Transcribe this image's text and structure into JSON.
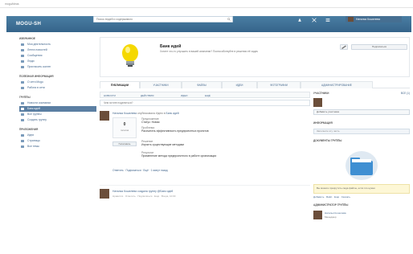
{
  "browser": {
    "address": "mogu/ideas"
  },
  "header": {
    "logo": "MOGU-SH",
    "search_placeholder": "Поиск людей и содержимого",
    "user_name": "Наталья Кошелева"
  },
  "sidebar": {
    "sections": [
      {
        "title": "Избранное",
        "items": [
          {
            "label": "Моя деятельность"
          },
          {
            "label": "Лента новостей"
          },
          {
            "label": "Сообщения"
          },
          {
            "label": "Люди"
          },
          {
            "label": "Пригласить коллег"
          }
        ]
      },
      {
        "title": "Полезная информация",
        "items": [
          {
            "label": "О сети Mogu"
          },
          {
            "label": "Работа в сети"
          }
        ]
      },
      {
        "title": "Группы",
        "items": [
          {
            "label": "Новости компании"
          },
          {
            "label": "Банк идей",
            "active": true
          },
          {
            "label": "Все группы"
          },
          {
            "label": "Создать группу"
          }
        ]
      },
      {
        "title": "Приложения",
        "items": [
          {
            "label": "Идеи"
          },
          {
            "label": "Страницы"
          },
          {
            "label": "Все темы"
          }
        ]
      }
    ]
  },
  "group": {
    "title": "Банк идей",
    "description": "Хотите что-то улучшить в вашей компании? Поспособствуйте в решении её задач",
    "join_label": "Подписаться"
  },
  "tabs": [
    "Публикации",
    "Участники",
    "Файлы",
    "Идеи",
    "Фотографии",
    "Администрирование"
  ],
  "feed": {
    "toolbar": [
      "Новости",
      "Действия",
      "Идеи",
      "Ещё"
    ],
    "post_placeholder": "Чем хотите поделиться?",
    "post1": {
      "author": "Наталья Кошелева",
      "action": "опубликовала Идею в",
      "group_link": "Банк идей",
      "votes": "0",
      "votes_label": "голосов",
      "vote_button": "Голосовать",
      "field1_k": "Предложение",
      "field1_v": "Статус: Новая",
      "field2_k": "Проблема",
      "field2_v": "Рассчитать эффективность предпроектных проектов",
      "field3_k": "Решение",
      "field3_v": "Изучить существующие методики",
      "field4_k": "Результат",
      "field4_v": "Применение метода предпроектного в работе организации",
      "footer": "Ответить · Подписаться · Ещё · 1 минут назад"
    },
    "post2": {
      "text": "Наталья Кошелева создала группу @Банк идей",
      "sub": "Нравится · Ответить · Подписаться · Ещё · Вчера, 10:00"
    }
  },
  "right": {
    "members_title": "Участники",
    "members_all": "Все (1)",
    "add_member": "Добавить участника",
    "info_title": "Информация",
    "info_field": "Заполните эту часть",
    "docs_title": "Документы группы",
    "docs_note": "Вы можете прокрутить сюда файлы, если это нужно",
    "docs_links": "Добавить · Файл · Ещё · Скачать",
    "admin_title": "Администратор группы",
    "admin_name": "Наталья Кошелева",
    "admin_role": "Менеджер"
  }
}
